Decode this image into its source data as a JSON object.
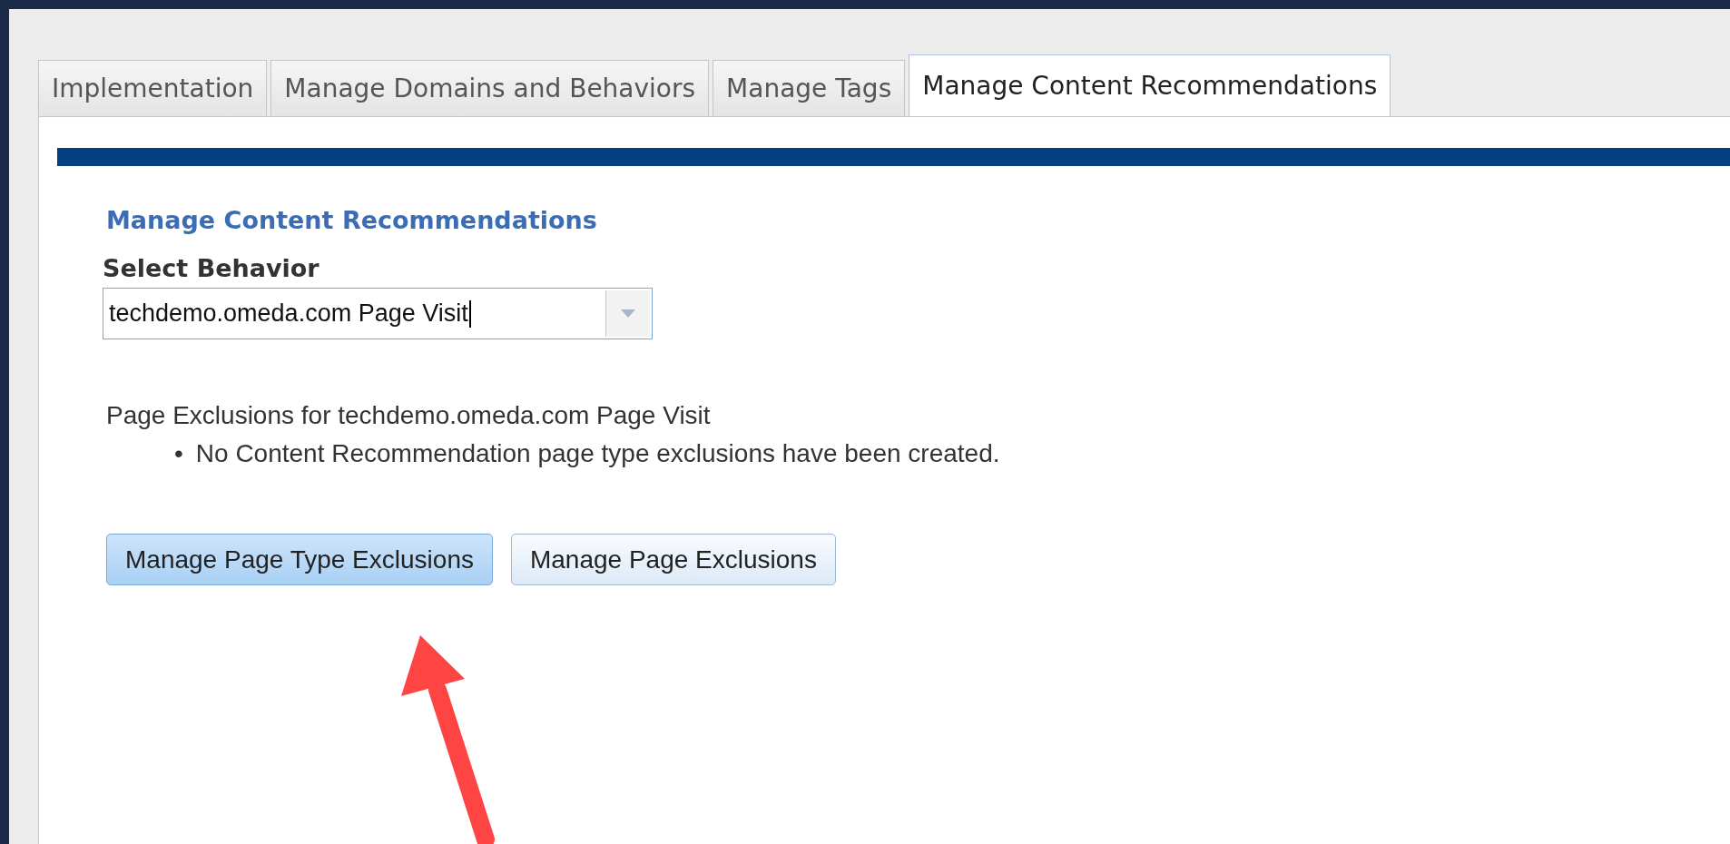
{
  "tabs": [
    {
      "label": "Implementation",
      "selected": false
    },
    {
      "label": "Manage Domains and Behaviors",
      "selected": false
    },
    {
      "label": "Manage Tags",
      "selected": false
    },
    {
      "label": "Manage Content Recommendations",
      "selected": true
    }
  ],
  "panel": {
    "title": "Manage Content Recommendations",
    "field_label": "Select Behavior",
    "behavior": {
      "value": "techdemo.omeda.com Page Visit"
    },
    "exclusions_title": "Page Exclusions for techdemo.omeda.com Page Visit",
    "exclusions": [
      {
        "bullet": "•",
        "text": "No Content Recommendation page type exclusions have been created."
      }
    ],
    "buttons": [
      {
        "label": "Manage Page Type Exclusions",
        "selected": true
      },
      {
        "label": "Manage Page Exclusions",
        "selected": false
      }
    ]
  }
}
